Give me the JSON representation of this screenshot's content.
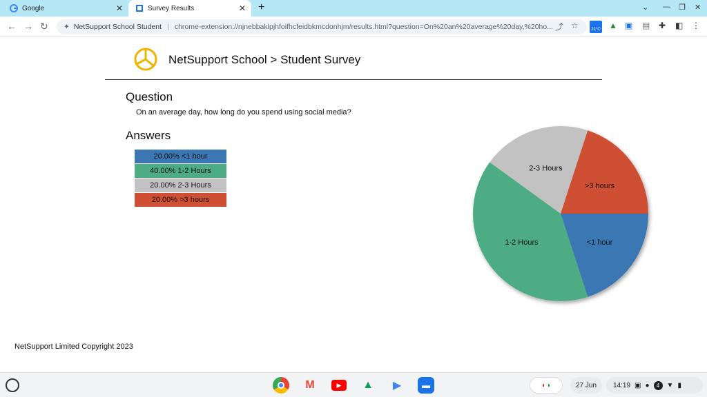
{
  "browser": {
    "tabs": [
      {
        "label": "Google"
      },
      {
        "label": "Survey Results"
      }
    ],
    "address": {
      "site_name": "NetSupport School Student",
      "url": "chrome-extension://njnebbaklpjhfoifhcfeidbkmcdonhjm/results.html?question=On%20an%20average%20day,%20ho..."
    },
    "weather_badge": "21°C"
  },
  "page": {
    "title": "NetSupport School > Student Survey",
    "question_heading": "Question",
    "question_text": "On an average day, how long do you spend using social media?",
    "answers_heading": "Answers",
    "legend": [
      {
        "label": "20.00% <1 hour",
        "color": "#3b77b3"
      },
      {
        "label": "40.00% 1-2 Hours",
        "color": "#4dac84"
      },
      {
        "label": "20.00% 2-3 Hours",
        "color": "#c2c2c2"
      },
      {
        "label": "20.00% >3 hours",
        "color": "#cf4f35"
      }
    ],
    "copyright": "NetSupport Limited Copyright 2023",
    "accent_color": "#f0b400"
  },
  "chart_data": {
    "type": "pie",
    "categories": [
      "<1 hour",
      "1-2 Hours",
      "2-3 Hours",
      ">3 hours"
    ],
    "values": [
      20,
      40,
      20,
      20
    ],
    "colors": [
      "#3b77b3",
      "#4dac84",
      "#c2c2c2",
      "#cf4f35"
    ]
  },
  "shelf": {
    "apps": [
      "chrome-icon",
      "gmail-icon",
      "youtube-icon",
      "drive-icon",
      "play-store-icon",
      "files-icon"
    ],
    "date": "27 Jun",
    "time": "14:19",
    "notification_count": "4"
  }
}
